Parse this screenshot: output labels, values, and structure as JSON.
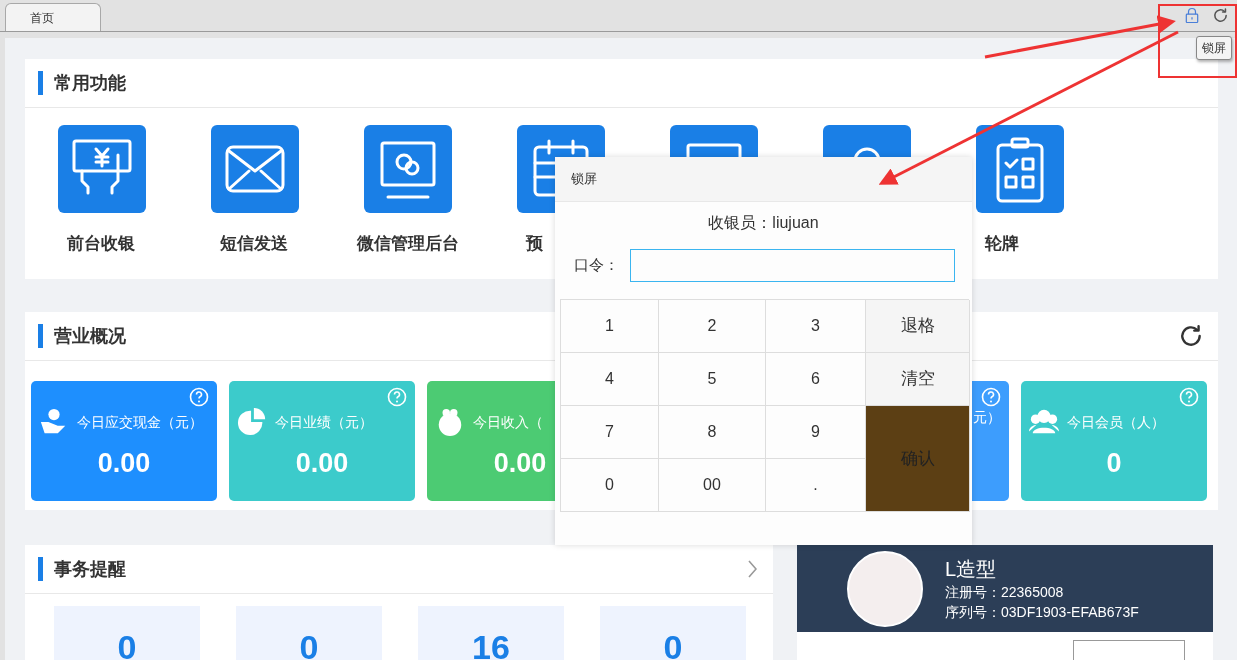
{
  "tabs": [
    {
      "label": "首页",
      "selected": true
    }
  ],
  "toolbar": {
    "tooltip": "锁屏"
  },
  "functions": {
    "title": "常用功能",
    "items": [
      {
        "kind": "labeled",
        "label": "前台收银"
      },
      {
        "kind": "labeled",
        "label": "短信发送"
      },
      {
        "kind": "labeled",
        "label": "微信管理后台"
      },
      {
        "kind": "labeled",
        "label": "预"
      },
      {
        "kind": "covered"
      },
      {
        "kind": "covered"
      },
      {
        "kind": "labeled",
        "label": "轮牌"
      }
    ]
  },
  "overview": {
    "title": "营业概况",
    "cards": [
      {
        "kind": "stat",
        "label": "今日应交现金（元）",
        "value": "0.00",
        "color": "#1e8ffe"
      },
      {
        "kind": "stat",
        "label": "今日业绩（元）",
        "value": "0.00",
        "color": "#3ccbcb"
      },
      {
        "kind": "stat",
        "label": "今日收入（",
        "value": "0.00",
        "color": "#4ccb73"
      },
      {
        "kind": "covered"
      },
      {
        "kind": "clipped",
        "label": "元）",
        "color": "#3d9dfd"
      },
      {
        "kind": "stat",
        "label": "今日会员（人）",
        "value": "0",
        "color": "#3ccbcb"
      }
    ]
  },
  "reminders": {
    "title": "事务提醒",
    "tiles": [
      "0",
      "0",
      "16",
      "0"
    ]
  },
  "profile": {
    "name": "L造型",
    "reg": "注册号：22365008",
    "serial": "序列号：03DF1903-EFAB673F"
  },
  "lock_dialog": {
    "title": "锁屏",
    "cashier": "收银员：liujuan",
    "password_label": "口令：",
    "keys": [
      {
        "label": "1",
        "kind": "digit"
      },
      {
        "label": "2",
        "kind": "digit"
      },
      {
        "label": "3",
        "kind": "digit"
      },
      {
        "label": "退格",
        "kind": "function"
      },
      {
        "label": "4",
        "kind": "digit"
      },
      {
        "label": "5",
        "kind": "digit"
      },
      {
        "label": "6",
        "kind": "digit"
      },
      {
        "label": "清空",
        "kind": "function"
      },
      {
        "label": "7",
        "kind": "digit"
      },
      {
        "label": "8",
        "kind": "digit"
      },
      {
        "label": "9",
        "kind": "digit"
      },
      {
        "label": "确认",
        "kind": "confirm"
      },
      {
        "label": "0",
        "kind": "digit"
      },
      {
        "label": "00",
        "kind": "digit"
      },
      {
        "label": ".",
        "kind": "digit"
      }
    ]
  }
}
